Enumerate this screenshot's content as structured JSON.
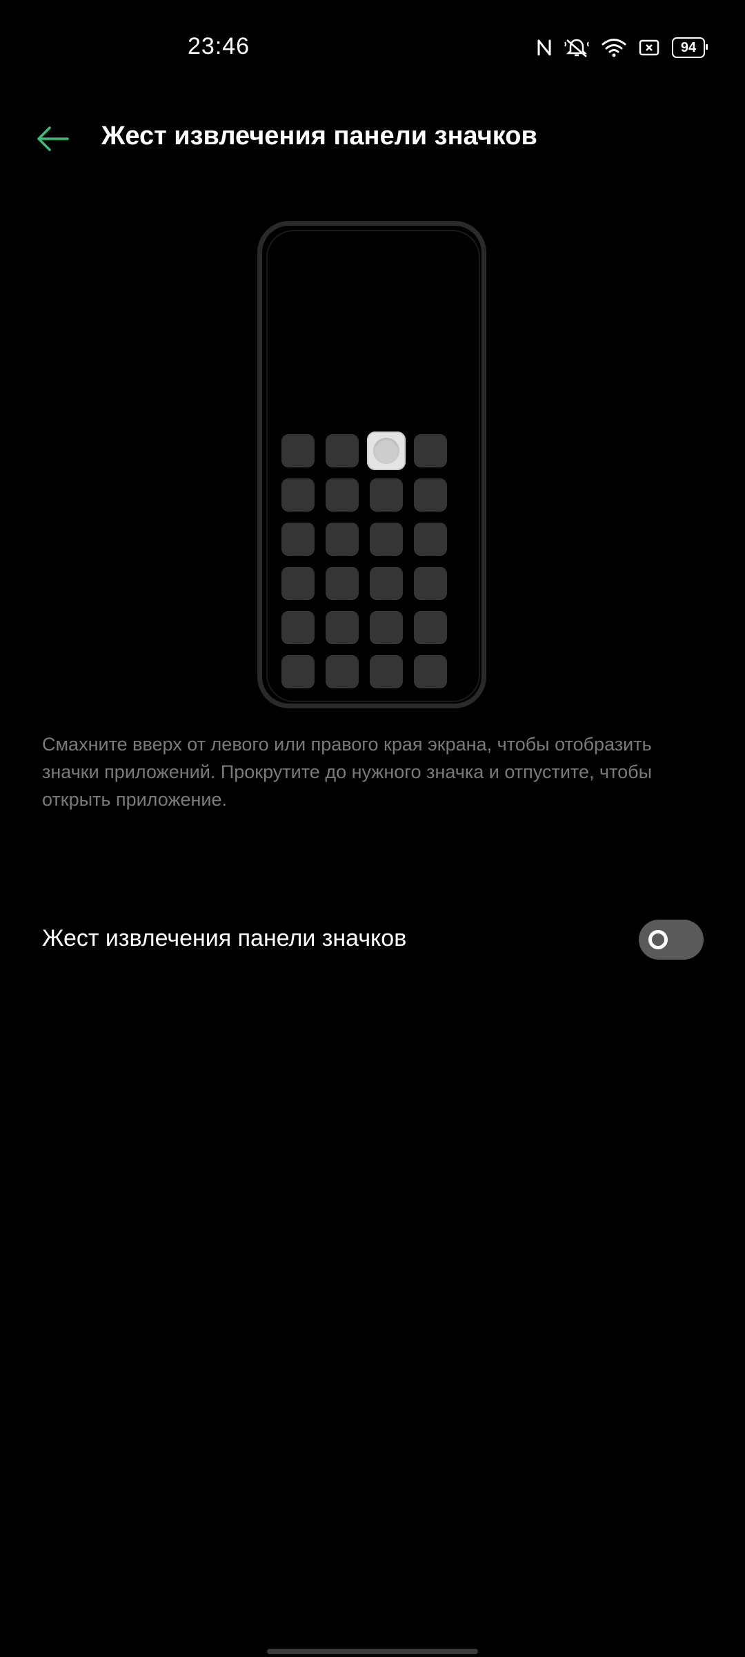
{
  "status_bar": {
    "time": "23:46",
    "battery_level": "94",
    "icons": [
      "nfc-icon",
      "mute-icon",
      "wifi-icon",
      "screen-icon",
      "battery-icon"
    ]
  },
  "header": {
    "back_icon": "back-arrow-icon",
    "title": "Жест извлечения панели значков"
  },
  "illustration": {
    "rows": 6,
    "columns": 4,
    "active_tile": {
      "row": 1,
      "column": 3
    }
  },
  "description": "Смахните вверх от левого или правого края экрана, чтобы отобразить значки приложений. Прокрутите до нужного значка и отпустите, чтобы открыть приложение.",
  "setting": {
    "label": "Жест извлечения панели значков",
    "enabled": false
  },
  "colors": {
    "background": "#000000",
    "accent": "#3dbf7a",
    "toggle_off": "#5a5a5a",
    "description_text": "#7a7a7a"
  }
}
